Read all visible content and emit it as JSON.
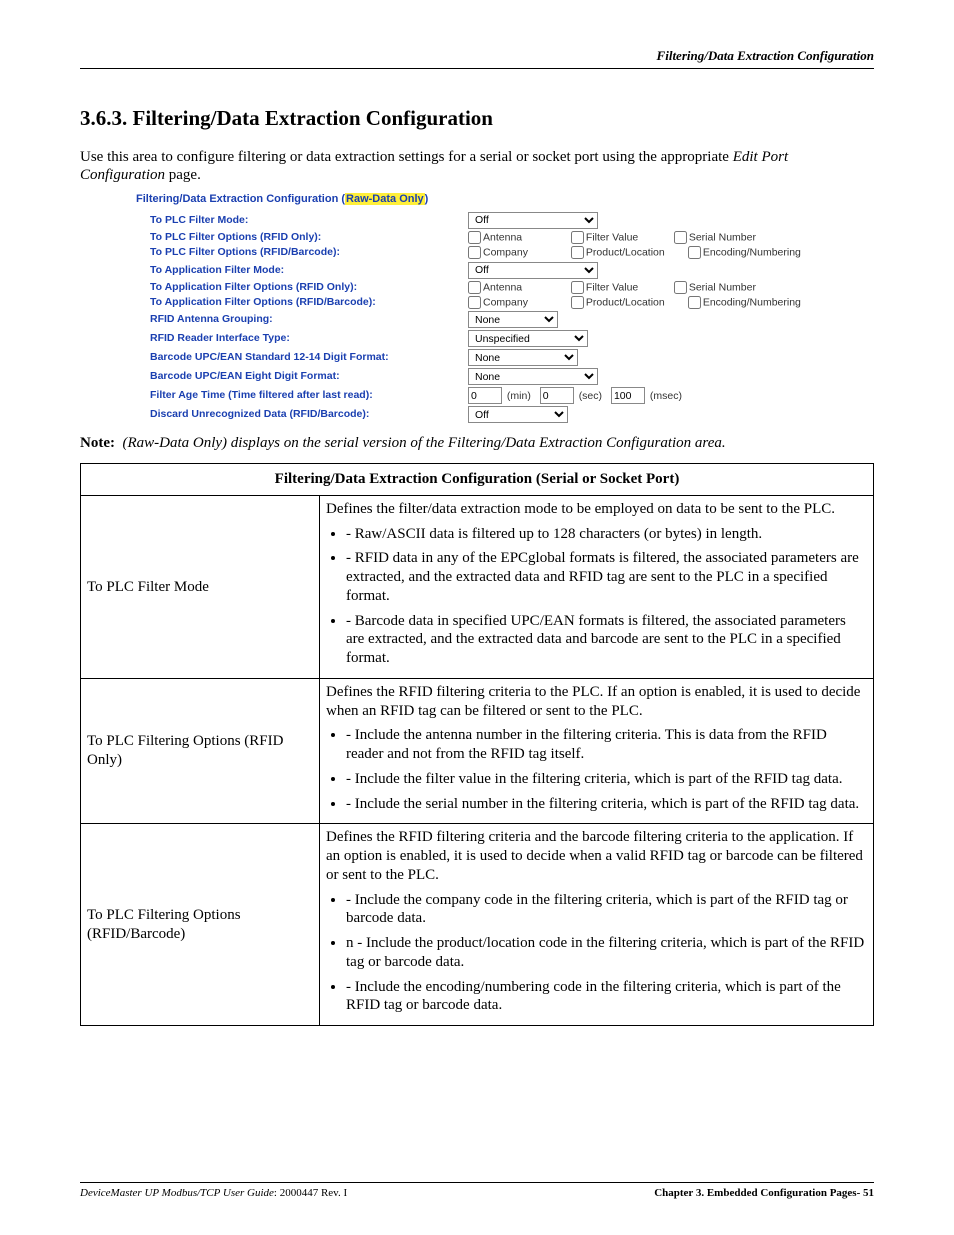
{
  "header": {
    "running": "Filtering/Data Extraction Configuration"
  },
  "section": {
    "number": "3.6.3.",
    "title": "Filtering/Data Extraction Configuration",
    "intro_a": "Use this area to configure filtering or data extraction settings for a serial or socket port using the appropriate ",
    "intro_em": "Edit Port Configuration",
    "intro_b": " page."
  },
  "mock": {
    "title_a": "Filtering/Data Extraction Configuration (",
    "title_hl": "Raw-Data Only",
    "title_b": ")",
    "labels": {
      "to_plc_mode": "To PLC Filter Mode:",
      "to_plc_rfid": "To PLC Filter Options (RFID Only):",
      "to_plc_rb": "To PLC Filter Options (RFID/Barcode):",
      "to_app_mode": "To Application Filter Mode:",
      "to_app_rfid": "To Application Filter Options (RFID Only):",
      "to_app_rb": "To Application Filter Options (RFID/Barcode):",
      "ant_group": "RFID Antenna Grouping:",
      "reader_if": "RFID Reader Interface Type:",
      "bc1214": "Barcode UPC/EAN Standard 12-14 Digit Format:",
      "bc8": "Barcode UPC/EAN Eight Digit Format:",
      "age": "Filter Age Time (Time filtered after last read):",
      "discard": "Discard Unrecognized Data (RFID/Barcode):"
    },
    "values": {
      "off": "Off",
      "none": "None",
      "unspec": "Unspecified",
      "antenna": "Antenna",
      "filter_value": "Filter Value",
      "serial": "Serial Number",
      "company": "Company",
      "prodloc": "Product/Location",
      "encnum": "Encoding/Numbering",
      "min": "(min)",
      "sec": "(sec)",
      "msec": "(msec)",
      "zero": "0",
      "hundred": "100"
    }
  },
  "note": {
    "label": "Note:",
    "text": "(Raw-Data Only) displays on the serial version of the Filtering/Data Extraction Configuration area."
  },
  "table": {
    "header": "Filtering/Data Extraction Configuration (Serial or Socket Port)",
    "rows": {
      "r1_label": "To PLC Filter Mode",
      "r1_p1": "Defines the filter/data extraction mode to be employed on data to be sent to the PLC.",
      "r1_b1": " - Raw/ASCII data is filtered up to 128 characters (or bytes) in length.",
      "r1_b2": " - RFID data in any of the EPCglobal formats is filtered, the associated parameters are extracted, and the extracted data and RFID tag are sent to the PLC in a specified format.",
      "r1_b3": " - Barcode data in specified UPC/EAN formats is filtered, the associated parameters are extracted, and the extracted data and barcode are sent to the PLC in a specified format.",
      "r2_label": "To PLC Filtering Options (RFID Only)",
      "r2_p1": "Defines the RFID filtering criteria to the PLC. If an option is enabled, it is used to decide when an RFID tag can be filtered or sent to the PLC.",
      "r2_b1": " - Include the antenna number in the filtering criteria. This is data from the RFID reader and not from the RFID tag itself.",
      "r2_b2": " - Include the filter value in the filtering criteria, which is part of the RFID tag data.",
      "r2_b3": " - Include the serial number in the filtering criteria, which is part of the RFID tag data.",
      "r3_label": "To PLC Filtering Options (RFID/Barcode)",
      "r3_p1": "Defines the RFID filtering criteria and the barcode filtering criteria to the application. If an option is enabled, it is used to decide when a valid RFID tag or barcode can be filtered or sent to the PLC.",
      "r3_b1": " - Include the company code in the filtering criteria, which is part of the RFID tag or barcode data.",
      "r3_b2": "n - Include the product/location code in the filtering criteria, which is part of the RFID tag or barcode data.",
      "r3_b3": " - Include the encoding/numbering code in the filtering criteria, which is part of the RFID tag or barcode data."
    }
  },
  "footer": {
    "left_a": "DeviceMaster UP Modbus/TCP User Guide",
    "left_b": ": 2000447 Rev. I",
    "right": "Chapter 3. Embedded Configuration Pages- 51"
  }
}
